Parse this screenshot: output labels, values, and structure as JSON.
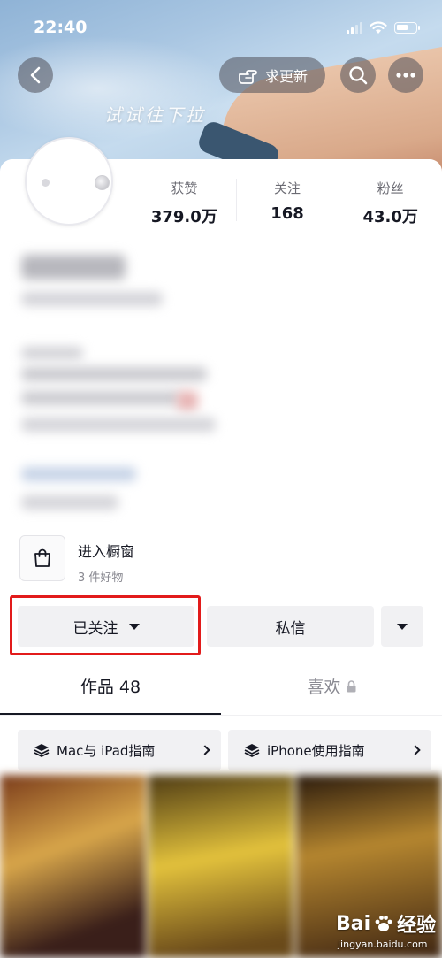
{
  "status_bar": {
    "time": "22:40"
  },
  "banner": {
    "pull_hint": "试试往下拉"
  },
  "nav": {
    "update_label": "求更新"
  },
  "stats": [
    {
      "label": "获赞",
      "value": "379.0万"
    },
    {
      "label": "关注",
      "value": "168"
    },
    {
      "label": "粉丝",
      "value": "43.0万"
    }
  ],
  "shop": {
    "title": "进入橱窗",
    "subtitle": "3 件好物"
  },
  "actions": {
    "followed_label": "已关注",
    "message_label": "私信"
  },
  "tabs": [
    {
      "label": "作品 48"
    },
    {
      "label": "喜欢"
    }
  ],
  "collections": [
    {
      "label": "Mac与 iPad指南"
    },
    {
      "label": "iPhone使用指南"
    }
  ],
  "watermark": {
    "brand": "Bai",
    "brand_suffix": "经验",
    "url": "jingyan.baidu.com"
  },
  "colors": {
    "highlight": "#e21b1b",
    "button_bg": "#f1f1f3",
    "text": "#161823"
  }
}
